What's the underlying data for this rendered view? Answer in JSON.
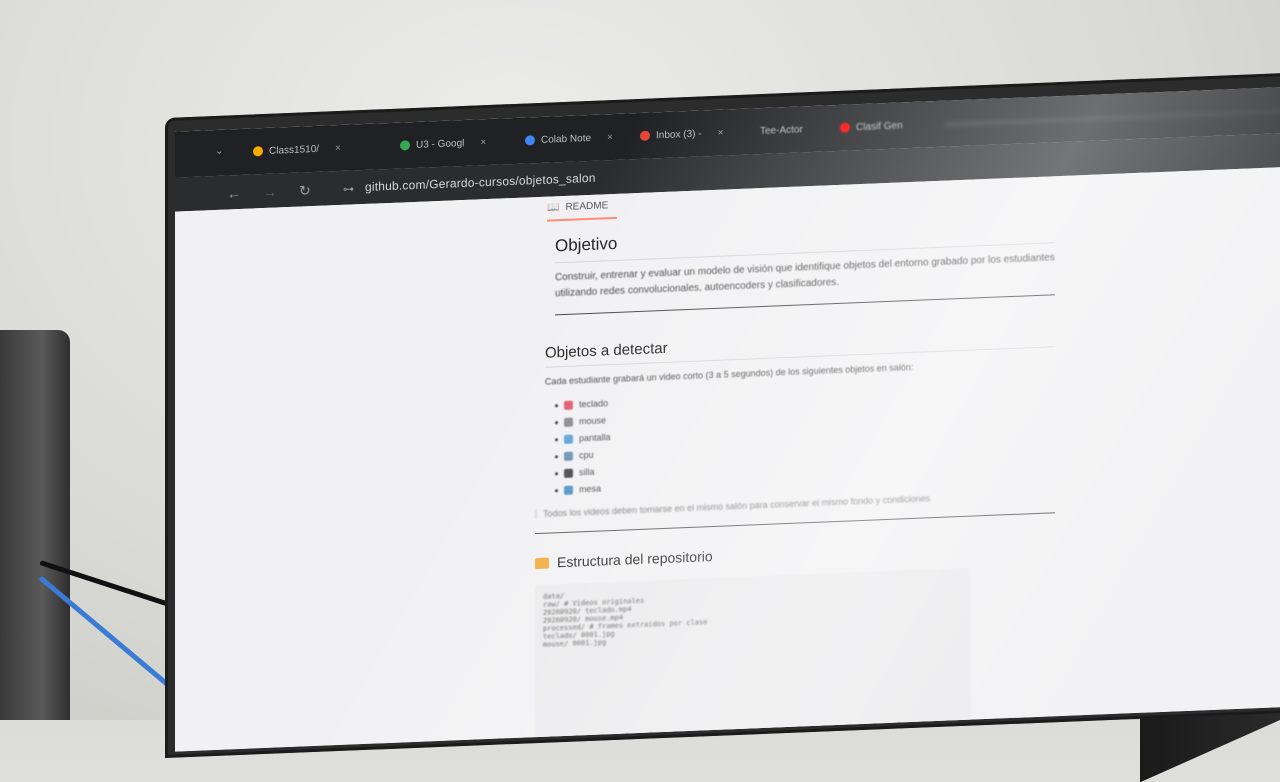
{
  "browser": {
    "tabs": [
      {
        "label": "Class1510/",
        "icon": "colab-icon",
        "color": "#f9ab00"
      },
      {
        "label": "U3 - Googl",
        "icon": "drive-icon",
        "color": "#34a853"
      },
      {
        "label": "Colab Note",
        "icon": "drive-icon",
        "color": "#4285f4"
      },
      {
        "label": "Inbox (3) -",
        "icon": "gmail-icon",
        "color": "#ea4335"
      },
      {
        "label": "Tee-Actor",
        "icon": "",
        "color": "#9aa0a6"
      },
      {
        "label": "Clasif Gen",
        "icon": "youtube-icon",
        "color": "#ff0000"
      }
    ],
    "close_glyph": "×",
    "url": "github.com/Gerardo-cursos/objetos_salon"
  },
  "readme": {
    "tab_label": "README",
    "sections": {
      "objetivo": {
        "title": "Objetivo",
        "text_line1": "Construir, entrenar y evaluar un modelo de visión que identifique objetos del entorno grabado por los estudiantes",
        "text_line2": "utilizando redes convolucionales, autoencoders y clasificadores."
      },
      "objetos": {
        "title": "Objetos a detectar",
        "intro": "Cada estudiante grabará un video corto (3 a 5 segundos) de los siguientes objetos en salón:",
        "items": [
          {
            "label": "teclado",
            "color": "#e05a6d"
          },
          {
            "label": "mouse",
            "color": "#8a8a8a"
          },
          {
            "label": "pantalla",
            "color": "#5aa0d8"
          },
          {
            "label": "cpu",
            "color": "#6c8fb5"
          },
          {
            "label": "silla",
            "color": "#444444"
          },
          {
            "label": "mesa",
            "color": "#4a90c8"
          }
        ],
        "note": "Todos los videos deben tomarse en el mismo salón para conservar el mismo fondo y condiciones"
      },
      "estructura": {
        "title": "Estructura del repositorio",
        "code_lines": [
          "data/",
          "  raw/    # Videos originales",
          "    20260920/ teclado.mp4",
          "    20260920/ mouse.mp4",
          "  processed/  # frames extraidos por clase",
          "    teclado/ 0001.jpg",
          "    mouse/  0001.jpg"
        ]
      }
    }
  }
}
